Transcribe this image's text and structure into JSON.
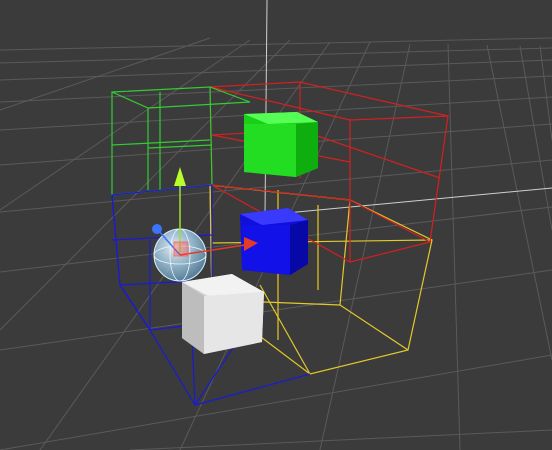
{
  "scene": {
    "background": "#3b3b3b",
    "grid_color": "#5a5a5a",
    "axis_color": "#cfcfcf",
    "wire_colors": {
      "green": "#33cc33",
      "red": "#d42020",
      "blue": "#1a1ad6",
      "yellow": "#e3c92a"
    }
  },
  "objects": [
    {
      "name": "green-cube",
      "color": "#22dd22"
    },
    {
      "name": "blue-cube",
      "color": "#1010d8"
    },
    {
      "name": "white-cube",
      "color": "#d8d8d8"
    },
    {
      "name": "glass-sphere",
      "color": "#bfe7ff"
    }
  ],
  "gizmo": {
    "y_handle_icon": "cone-up-icon",
    "x_handle_icon": "cone-right-icon",
    "z_handle_icon": "sphere-handle-icon",
    "y_color": "#b6ff2a",
    "x_color": "#e23b2b",
    "z_color": "#3a74ff"
  }
}
